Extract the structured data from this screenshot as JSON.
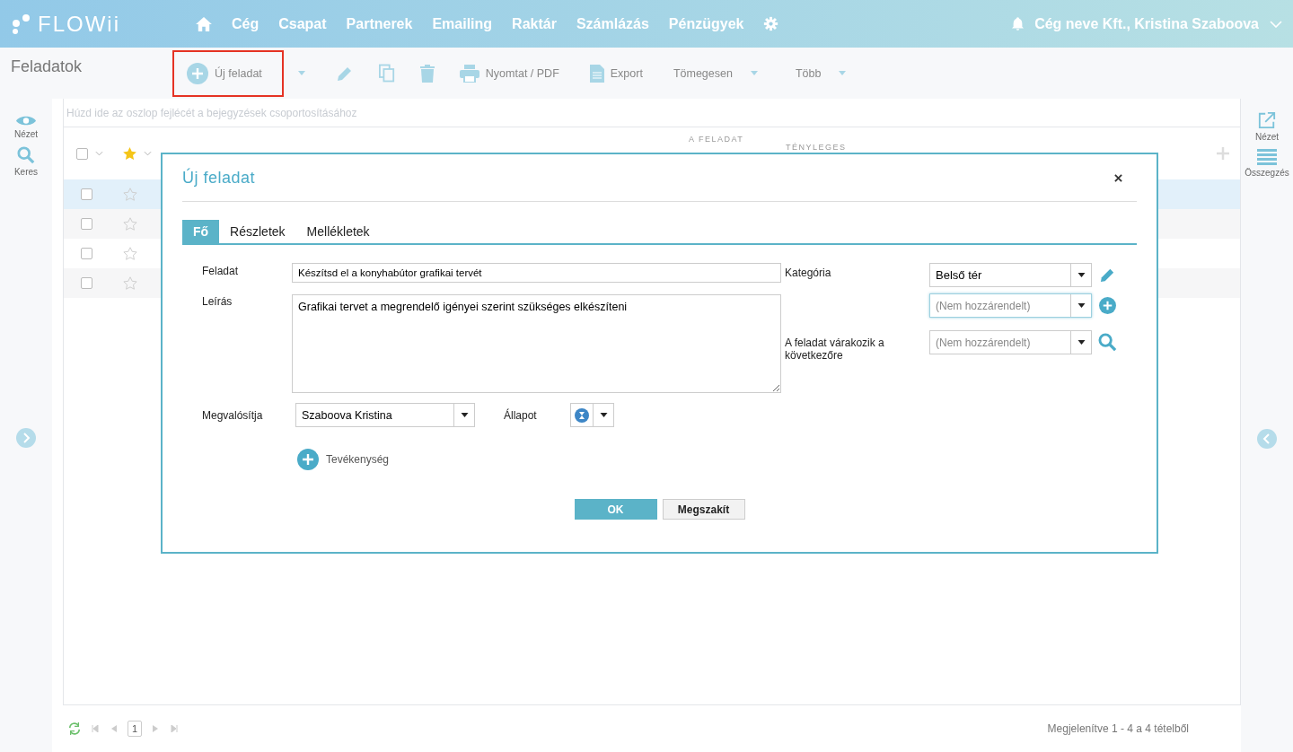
{
  "app": {
    "logo": "FLOWii",
    "nav": [
      {
        "label": "Cég"
      },
      {
        "label": "Csapat"
      },
      {
        "label": "Partnerek"
      },
      {
        "label": "Emailing"
      },
      {
        "label": "Raktár"
      },
      {
        "label": "Számlázás"
      },
      {
        "label": "Pénzügyek"
      }
    ],
    "account": "Cég neve Kft., Kristina Szaboova"
  },
  "page_title": "Feladatok",
  "toolbar": {
    "new_task": "Új feladat",
    "print": "Nyomtat / PDF",
    "export": "Export",
    "bulk": "Tömegesen",
    "more": "Több"
  },
  "left_panel": [
    {
      "kind": "eye",
      "label": "Nézet"
    },
    {
      "kind": "search",
      "label": "Keres"
    }
  ],
  "right_panel": [
    {
      "kind": "external",
      "label": "Nézet"
    },
    {
      "kind": "list",
      "label": "Összegzés"
    }
  ],
  "grid": {
    "group_hint": "Húzd ide az oszlop fejlécét a bejegyzések csoportosításához",
    "columns": [
      "A FELADAT",
      "TÉNYLEGES"
    ],
    "all_checked": false,
    "rows": [
      {
        "selected": true,
        "checked": false,
        "starred": false
      },
      {
        "selected": false,
        "checked": false,
        "starred": false
      },
      {
        "selected": false,
        "checked": false,
        "starred": false
      },
      {
        "selected": false,
        "checked": false,
        "starred": false
      }
    ]
  },
  "dialog": {
    "title": "Új feladat",
    "tabs": [
      {
        "label": "Fő",
        "selected": true
      },
      {
        "label": "Részletek",
        "selected": false
      },
      {
        "label": "Mellékletek",
        "selected": false
      }
    ],
    "task": {
      "label": "Feladat",
      "value": "Készítsd el a konyhabútor grafikai tervét"
    },
    "description": {
      "label": "Leírás",
      "value": "Grafikai tervet a megrendelő igényei szerint szükséges elkészíteni"
    },
    "category": {
      "label": "Kategória",
      "value": "Belső tér"
    },
    "linked": {
      "placeholder": "(Nem hozzárendelt)"
    },
    "waits_for": {
      "label": "A feladat várakozik a következőre",
      "placeholder": "(Nem hozzárendelt)"
    },
    "assignee": {
      "label": "Megvalósítja",
      "value": "Szaboova Kristina"
    },
    "status": {
      "label": "Állapot"
    },
    "activity": "Tevékenység",
    "ok": "OK",
    "cancel": "Megszakít"
  },
  "footer": {
    "page": "1",
    "summary": "Megjelenítve 1 - 4 a 4 tételből"
  }
}
